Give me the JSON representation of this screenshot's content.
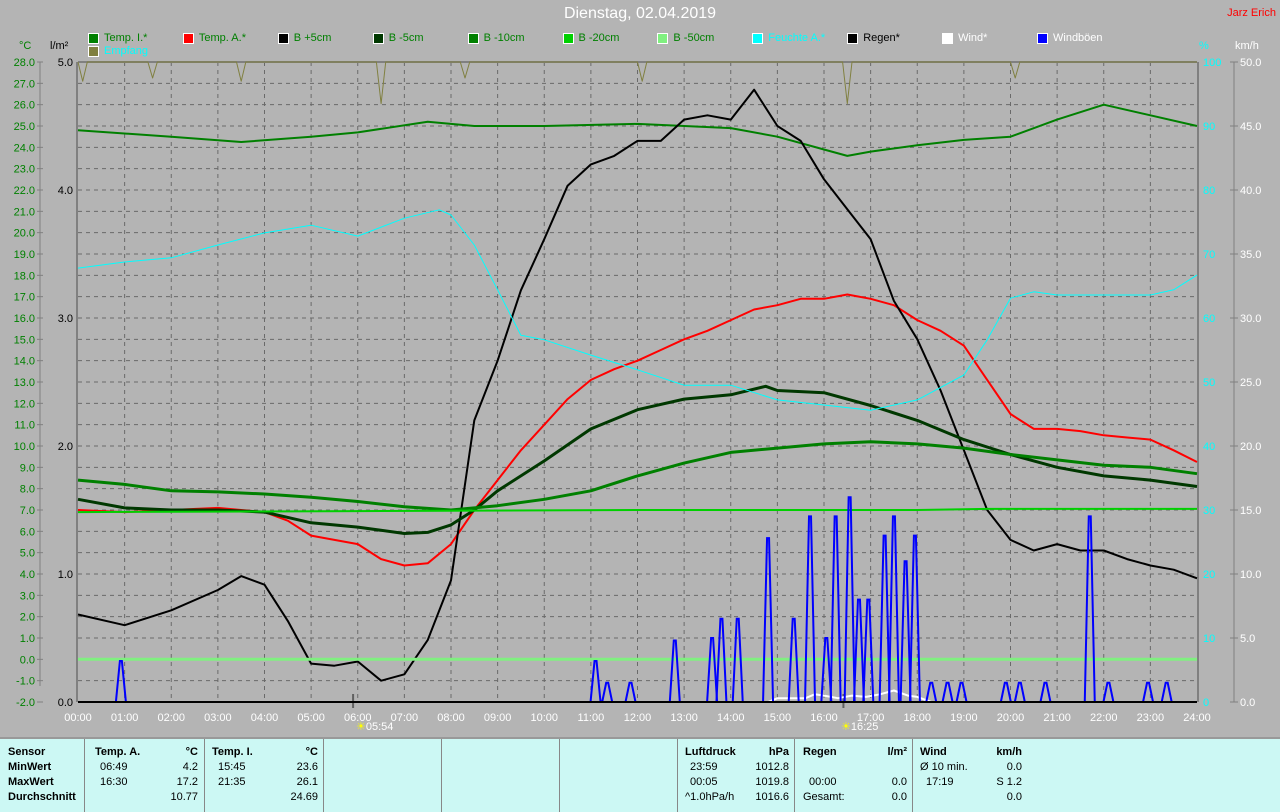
{
  "header": {
    "title": "Dienstag, 02.04.2019",
    "author": "Jarz Erich"
  },
  "legend": [
    {
      "label": "Temp. I.*",
      "color": "#008000",
      "text_color": "#008000"
    },
    {
      "label": "Temp. A.*",
      "color": "#ff0000",
      "text_color": "#008000"
    },
    {
      "label": "B +5cm",
      "color": "#000000",
      "text_color": "#008000"
    },
    {
      "label": "B -5cm",
      "color": "#003800",
      "text_color": "#008000"
    },
    {
      "label": "B -10cm",
      "color": "#008000",
      "text_color": "#008000"
    },
    {
      "label": "B -20cm",
      "color": "#00d000",
      "text_color": "#008000"
    },
    {
      "label": "B -50cm",
      "color": "#80f080",
      "text_color": "#008000"
    },
    {
      "label": "Feuchte A.*",
      "color": "#00ffff",
      "text_color": "#00ffff"
    },
    {
      "label": "Regen*",
      "color": "#000000",
      "text_color": "#000000"
    },
    {
      "label": "Wind*",
      "color": "#ffffff",
      "text_color": "#ffffff"
    },
    {
      "label": "Windböen",
      "color": "#0000ff",
      "text_color": "#ffffff"
    },
    {
      "label": "Empfang",
      "color": "#808040",
      "text_color": "#00ffff"
    }
  ],
  "axes": {
    "temp_unit": "°C",
    "rain_unit": "l/m²",
    "hum_unit": "%",
    "wind_unit": "km/h"
  },
  "sun": {
    "sunrise": "05:54",
    "sunset": "16:25"
  },
  "chart_data": {
    "type": "line",
    "title": "Dienstag, 02.04.2019",
    "xlabel": "",
    "x_ticks": [
      "00:00",
      "01:00",
      "02:00",
      "03:00",
      "04:00",
      "05:00",
      "06:00",
      "07:00",
      "08:00",
      "09:00",
      "10:00",
      "11:00",
      "12:00",
      "13:00",
      "14:00",
      "15:00",
      "16:00",
      "17:00",
      "18:00",
      "19:00",
      "20:00",
      "21:00",
      "22:00",
      "23:00",
      "24:00"
    ],
    "xlim_hours": [
      0,
      24
    ],
    "y_axes": {
      "temp": {
        "unit": "°C",
        "range": [
          -2,
          28
        ],
        "ticks": [
          "28.0",
          "27.0",
          "26.0",
          "25.0",
          "24.0",
          "23.0",
          "22.0",
          "21.0",
          "20.0",
          "19.0",
          "18.0",
          "17.0",
          "16.0",
          "15.0",
          "14.0",
          "13.0",
          "12.0",
          "11.0",
          "10.0",
          "9.0",
          "8.0",
          "7.0",
          "6.0",
          "5.0",
          "4.0",
          "3.0",
          "2.0",
          "1.0",
          "0.0",
          "-1.0",
          "-2.0"
        ]
      },
      "rain": {
        "unit": "l/m²",
        "range": [
          0,
          5
        ],
        "ticks": [
          "5.0",
          "4.0",
          "3.0",
          "2.0",
          "1.0",
          "0.0"
        ]
      },
      "humidity": {
        "unit": "%",
        "range": [
          0,
          100
        ],
        "ticks": [
          "100",
          "90",
          "80",
          "70",
          "60",
          "50",
          "40",
          "30",
          "20",
          "10",
          "0"
        ]
      },
      "wind": {
        "unit": "km/h",
        "range": [
          0,
          50
        ],
        "ticks": [
          "50.0",
          "45.0",
          "40.0",
          "35.0",
          "30.0",
          "25.0",
          "20.0",
          "15.0",
          "10.0",
          "5.0",
          "0.0"
        ]
      }
    },
    "grid": true,
    "series": [
      {
        "name": "Temp. I.*",
        "axis": "temp",
        "color": "#008000",
        "width": 2,
        "x": [
          0,
          2,
          3.5,
          5,
          6,
          7.5,
          8.5,
          10,
          12,
          14,
          15,
          16,
          16.5,
          17,
          18,
          19,
          20,
          21,
          22,
          23,
          24
        ],
        "y": [
          24.8,
          24.5,
          24.25,
          24.5,
          24.7,
          25.2,
          25.0,
          25.0,
          25.1,
          24.9,
          24.5,
          23.9,
          23.6,
          23.8,
          24.1,
          24.35,
          24.5,
          25.3,
          26.0,
          25.5,
          25.0
        ]
      },
      {
        "name": "Temp. A.*",
        "axis": "temp",
        "color": "#ff0000",
        "width": 2,
        "x": [
          0,
          1,
          2,
          3,
          4,
          4.5,
          5,
          5.5,
          6,
          6.5,
          7,
          7.5,
          8,
          8.5,
          9,
          9.5,
          10,
          10.5,
          11,
          11.5,
          12,
          12.5,
          13,
          13.5,
          14,
          14.5,
          15,
          15.5,
          16,
          16.5,
          17,
          17.5,
          18,
          18.5,
          19,
          19.5,
          20,
          20.5,
          21,
          21.5,
          22,
          22.5,
          23,
          23.5,
          24
        ],
        "y": [
          7.0,
          6.9,
          7.0,
          7.1,
          6.9,
          6.5,
          5.8,
          5.6,
          5.4,
          4.7,
          4.4,
          4.5,
          5.4,
          7.0,
          8.4,
          9.8,
          11.0,
          12.2,
          13.1,
          13.6,
          14.0,
          14.5,
          15.0,
          15.4,
          15.9,
          16.4,
          16.6,
          16.9,
          16.9,
          17.1,
          16.9,
          16.6,
          15.9,
          15.4,
          14.7,
          13.1,
          11.5,
          10.8,
          10.8,
          10.7,
          10.5,
          10.4,
          10.3,
          9.8,
          9.25
        ]
      },
      {
        "name": "B +5cm",
        "axis": "temp",
        "color": "#000000",
        "width": 2,
        "x": [
          0,
          1,
          2,
          3,
          3.5,
          4,
          4.5,
          5,
          5.5,
          6,
          6.5,
          7,
          7.5,
          8,
          8.5,
          9,
          9.5,
          10,
          10.5,
          11,
          11.5,
          12,
          12.5,
          13,
          13.5,
          14,
          14.5,
          15,
          15.5,
          16,
          16.5,
          17,
          17.5,
          18,
          18.5,
          19,
          19.5,
          20,
          20.5,
          21,
          21.5,
          22,
          22.5,
          23,
          23.5,
          24
        ],
        "y": [
          2.1,
          1.6,
          2.3,
          3.25,
          3.9,
          3.5,
          1.8,
          -0.2,
          -0.3,
          -0.1,
          -1.0,
          -0.7,
          0.9,
          3.7,
          11.2,
          14.0,
          17.3,
          19.7,
          22.2,
          23.2,
          23.6,
          24.3,
          24.3,
          25.3,
          25.5,
          25.3,
          26.7,
          25.0,
          24.3,
          22.5,
          21.1,
          19.7,
          16.8,
          15.0,
          12.6,
          9.8,
          7.0,
          5.6,
          5.1,
          5.4,
          5.1,
          5.1,
          4.7,
          4.4,
          4.2,
          3.8
        ]
      },
      {
        "name": "B -5cm",
        "axis": "temp",
        "color": "#003800",
        "width": 3,
        "x": [
          0,
          1,
          2,
          3,
          4,
          5,
          6,
          7,
          7.5,
          8,
          8.5,
          9,
          10,
          11,
          12,
          13,
          14,
          14.75,
          15,
          16,
          17,
          18,
          19,
          20,
          21,
          22,
          23,
          24
        ],
        "y": [
          7.5,
          7.1,
          7.0,
          7.0,
          6.9,
          6.4,
          6.2,
          5.9,
          5.95,
          6.3,
          7.0,
          7.9,
          9.3,
          10.8,
          11.7,
          12.2,
          12.4,
          12.8,
          12.6,
          12.5,
          11.9,
          11.2,
          10.3,
          9.6,
          9.0,
          8.6,
          8.4,
          8.1
        ]
      },
      {
        "name": "B -10cm",
        "axis": "temp",
        "color": "#008000",
        "width": 3,
        "x": [
          0,
          1,
          2,
          3,
          4,
          5,
          6,
          7,
          8,
          9,
          10,
          11,
          12,
          13,
          14,
          15,
          16,
          17,
          18,
          19,
          20,
          21,
          22,
          23,
          24
        ],
        "y": [
          8.4,
          8.2,
          7.9,
          7.85,
          7.75,
          7.6,
          7.4,
          7.15,
          7.0,
          7.2,
          7.5,
          7.9,
          8.6,
          9.2,
          9.7,
          9.9,
          10.1,
          10.2,
          10.1,
          9.9,
          9.6,
          9.35,
          9.1,
          9.0,
          8.7
        ]
      },
      {
        "name": "B -20cm",
        "axis": "temp",
        "color": "#00d000",
        "width": 2,
        "x": [
          0,
          6,
          12,
          18,
          19.5,
          24
        ],
        "y": [
          6.9,
          6.95,
          7.0,
          7.0,
          7.05,
          7.05
        ]
      },
      {
        "name": "B -50cm",
        "axis": "temp",
        "color": "#80f080",
        "width": 3,
        "x": [
          0,
          24
        ],
        "y": [
          0.0,
          0.0
        ]
      },
      {
        "name": "Feuchte A.*",
        "axis": "humidity",
        "color": "#00ffff",
        "width": 1,
        "x": [
          0,
          1,
          2,
          3,
          4,
          5,
          6,
          7,
          7.75,
          8,
          8.5,
          9,
          9.5,
          10,
          11,
          12,
          13,
          14,
          15,
          16,
          17,
          18,
          19,
          19.5,
          20,
          20.5,
          21,
          22,
          23,
          23.5,
          24
        ],
        "y": [
          67.8,
          68.75,
          69.4,
          71.4,
          73.3,
          74.5,
          72.8,
          75.6,
          76.9,
          76.1,
          71.4,
          64.4,
          57.3,
          56.6,
          54.2,
          51.9,
          49.5,
          49.5,
          47.2,
          46.4,
          45.6,
          47.2,
          51.1,
          56.6,
          63.1,
          64.1,
          63.6,
          63.6,
          63.6,
          64.4,
          66.7
        ]
      },
      {
        "name": "Empfang",
        "axis": "humidity",
        "color": "#808040",
        "width": 1,
        "x": [
          0,
          0.1,
          0.2,
          1.5,
          1.6,
          1.7,
          3.4,
          3.5,
          3.6,
          6.4,
          6.5,
          6.6,
          8.2,
          8.3,
          8.4,
          12,
          12.1,
          12.2,
          16.4,
          16.5,
          16.6,
          20,
          20.1,
          20.2,
          24
        ],
        "y": [
          100,
          97,
          100,
          100,
          97.5,
          100,
          100,
          97,
          100,
          100,
          93.5,
          100,
          100,
          97.5,
          100,
          100,
          97,
          100,
          100,
          93.5,
          100,
          100,
          97.5,
          100,
          100
        ]
      },
      {
        "name": "Regen*",
        "axis": "rain",
        "color": "#000000",
        "width": 2,
        "x": [
          0,
          24
        ],
        "y": [
          0,
          0
        ]
      },
      {
        "name": "Wind*",
        "axis": "wind",
        "color": "#ffffff",
        "width": 2,
        "x": [
          0,
          14.8,
          15,
          15.6,
          15.8,
          16,
          16.3,
          16.6,
          16.9,
          17.2,
          17.5,
          17.8,
          18,
          18.3,
          24
        ],
        "y": [
          0,
          0,
          0.3,
          0.3,
          0.6,
          0.5,
          0.3,
          0.5,
          0.4,
          0.6,
          0.9,
          0.5,
          0.4,
          0,
          0
        ]
      },
      {
        "name": "Windböen",
        "axis": "wind",
        "color": "#0000ff",
        "width": 2,
        "type": "spikes",
        "x": [
          0.92,
          11.1,
          11.35,
          11.85,
          12.8,
          13.6,
          13.8,
          14.15,
          14.8,
          15.35,
          15.7,
          16.05,
          16.25,
          16.55,
          16.75,
          16.95,
          17.3,
          17.5,
          17.75,
          17.95,
          18.3,
          18.65,
          18.95,
          19.9,
          20.2,
          20.75,
          21.7,
          22.1,
          22.95,
          23.35
        ],
        "y": [
          3.2,
          3.2,
          1.5,
          1.5,
          4.8,
          5.0,
          6.5,
          6.5,
          12.8,
          6.5,
          14.5,
          5.0,
          14.5,
          16.0,
          8.0,
          8.0,
          13.0,
          14.5,
          11.0,
          13.0,
          1.5,
          1.5,
          1.5,
          1.5,
          1.5,
          1.5,
          14.5,
          1.5,
          1.5,
          1.5
        ]
      }
    ]
  },
  "footer": {
    "sensor": {
      "header": "Sensor",
      "rows": [
        "MinWert",
        "MaxWert",
        "Durchschnitt"
      ]
    },
    "temp_a": {
      "header": "Temp. A.",
      "unit": "°C",
      "min_time": "06:49",
      "min": "4.2",
      "max_time": "16:30",
      "max": "17.2",
      "avg": "10.77"
    },
    "temp_i": {
      "header": "Temp. I.",
      "unit": "°C",
      "min_time": "15:45",
      "min": "23.6",
      "max_time": "21:35",
      "max": "26.1",
      "avg": "24.69"
    },
    "pressure": {
      "header": "Luftdruck",
      "unit": "hPa",
      "min_time": "23:59",
      "min": "1012.8",
      "max_time": "00:05",
      "max": "1019.8",
      "trend": "^1.0hPa/h",
      "avg": "1016.6"
    },
    "rain": {
      "header": "Regen",
      "unit": "l/m²",
      "max_time": "00:00",
      "max": "0.0",
      "total_label": "Gesamt:",
      "total": "0.0"
    },
    "wind": {
      "header": "Wind",
      "unit": "km/h",
      "avg_label": "Ø 10 min.",
      "avg": "0.0",
      "max_time": "17:19",
      "max": "S 1.2",
      "total": "0.0"
    }
  }
}
